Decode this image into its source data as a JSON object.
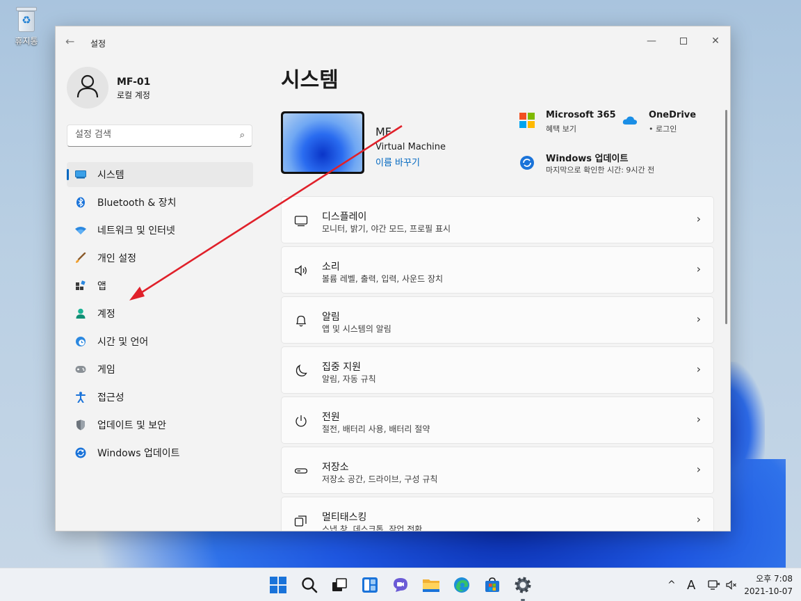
{
  "desktop": {
    "recycle_bin_label": "휴지통"
  },
  "window": {
    "title": "설정",
    "controls": {
      "minimize": "—",
      "maximize": "□",
      "close": "✕"
    }
  },
  "profile": {
    "name": "MF-01",
    "account_type": "로컬 계정"
  },
  "search": {
    "placeholder": "설정 검색"
  },
  "sidebar": {
    "items": [
      {
        "label": "시스템",
        "icon": "system-icon",
        "active": true
      },
      {
        "label": "Bluetooth & 장치",
        "icon": "bluetooth-icon"
      },
      {
        "label": "네트워크 및 인터넷",
        "icon": "wifi-icon"
      },
      {
        "label": "개인 설정",
        "icon": "brush-icon"
      },
      {
        "label": "앱",
        "icon": "apps-icon"
      },
      {
        "label": "계정",
        "icon": "account-icon"
      },
      {
        "label": "시간 및 언어",
        "icon": "time-language-icon"
      },
      {
        "label": "게임",
        "icon": "gaming-icon"
      },
      {
        "label": "접근성",
        "icon": "accessibility-icon"
      },
      {
        "label": "업데이트 및 보안",
        "icon": "shield-icon"
      },
      {
        "label": "Windows 업데이트",
        "icon": "windows-update-icon"
      }
    ]
  },
  "main": {
    "title": "시스템",
    "device": {
      "name": "MF",
      "model": "Virtual Machine",
      "rename_link": "이름 바꾸기"
    },
    "quick_links": {
      "ms365": {
        "title": "Microsoft 365",
        "subtitle": "혜택 보기"
      },
      "onedrive": {
        "title": "OneDrive",
        "subtitle": "• 로그인"
      },
      "windows_update": {
        "title": "Windows 업데이트",
        "subtitle": "마지막으로 확인한 시간: 9시간 전"
      }
    },
    "cards": [
      {
        "title": "디스플레이",
        "subtitle": "모니터, 밝기, 야간 모드, 프로필 표시",
        "icon": "display-icon"
      },
      {
        "title": "소리",
        "subtitle": "볼륨 레벨, 출력, 입력, 사운드 장치",
        "icon": "speaker-icon"
      },
      {
        "title": "알림",
        "subtitle": "앱 및 시스템의 알림",
        "icon": "bell-icon"
      },
      {
        "title": "집중 지원",
        "subtitle": "알림, 자동 규칙",
        "icon": "moon-icon"
      },
      {
        "title": "전원",
        "subtitle": "절전, 배터리 사용, 배터리 절약",
        "icon": "power-icon"
      },
      {
        "title": "저장소",
        "subtitle": "저장소 공간, 드라이브, 구성 규칙",
        "icon": "storage-icon"
      },
      {
        "title": "멀티태스킹",
        "subtitle": "스냅 창, 데스크톱, 작업 전환",
        "icon": "multitasking-icon"
      }
    ]
  },
  "taskbar": {
    "apps": [
      "start-icon",
      "search-icon",
      "task-view-icon",
      "widgets-icon",
      "chat-icon",
      "file-explorer-icon",
      "edge-icon",
      "store-icon",
      "settings-icon"
    ],
    "tray": {
      "chevron": "^",
      "ime": "A"
    },
    "clock": {
      "time": "오후 7:08",
      "date": "2021-10-07"
    }
  },
  "colors": {
    "accent": "#0067c0",
    "annotation_arrow": "#e0202a"
  }
}
